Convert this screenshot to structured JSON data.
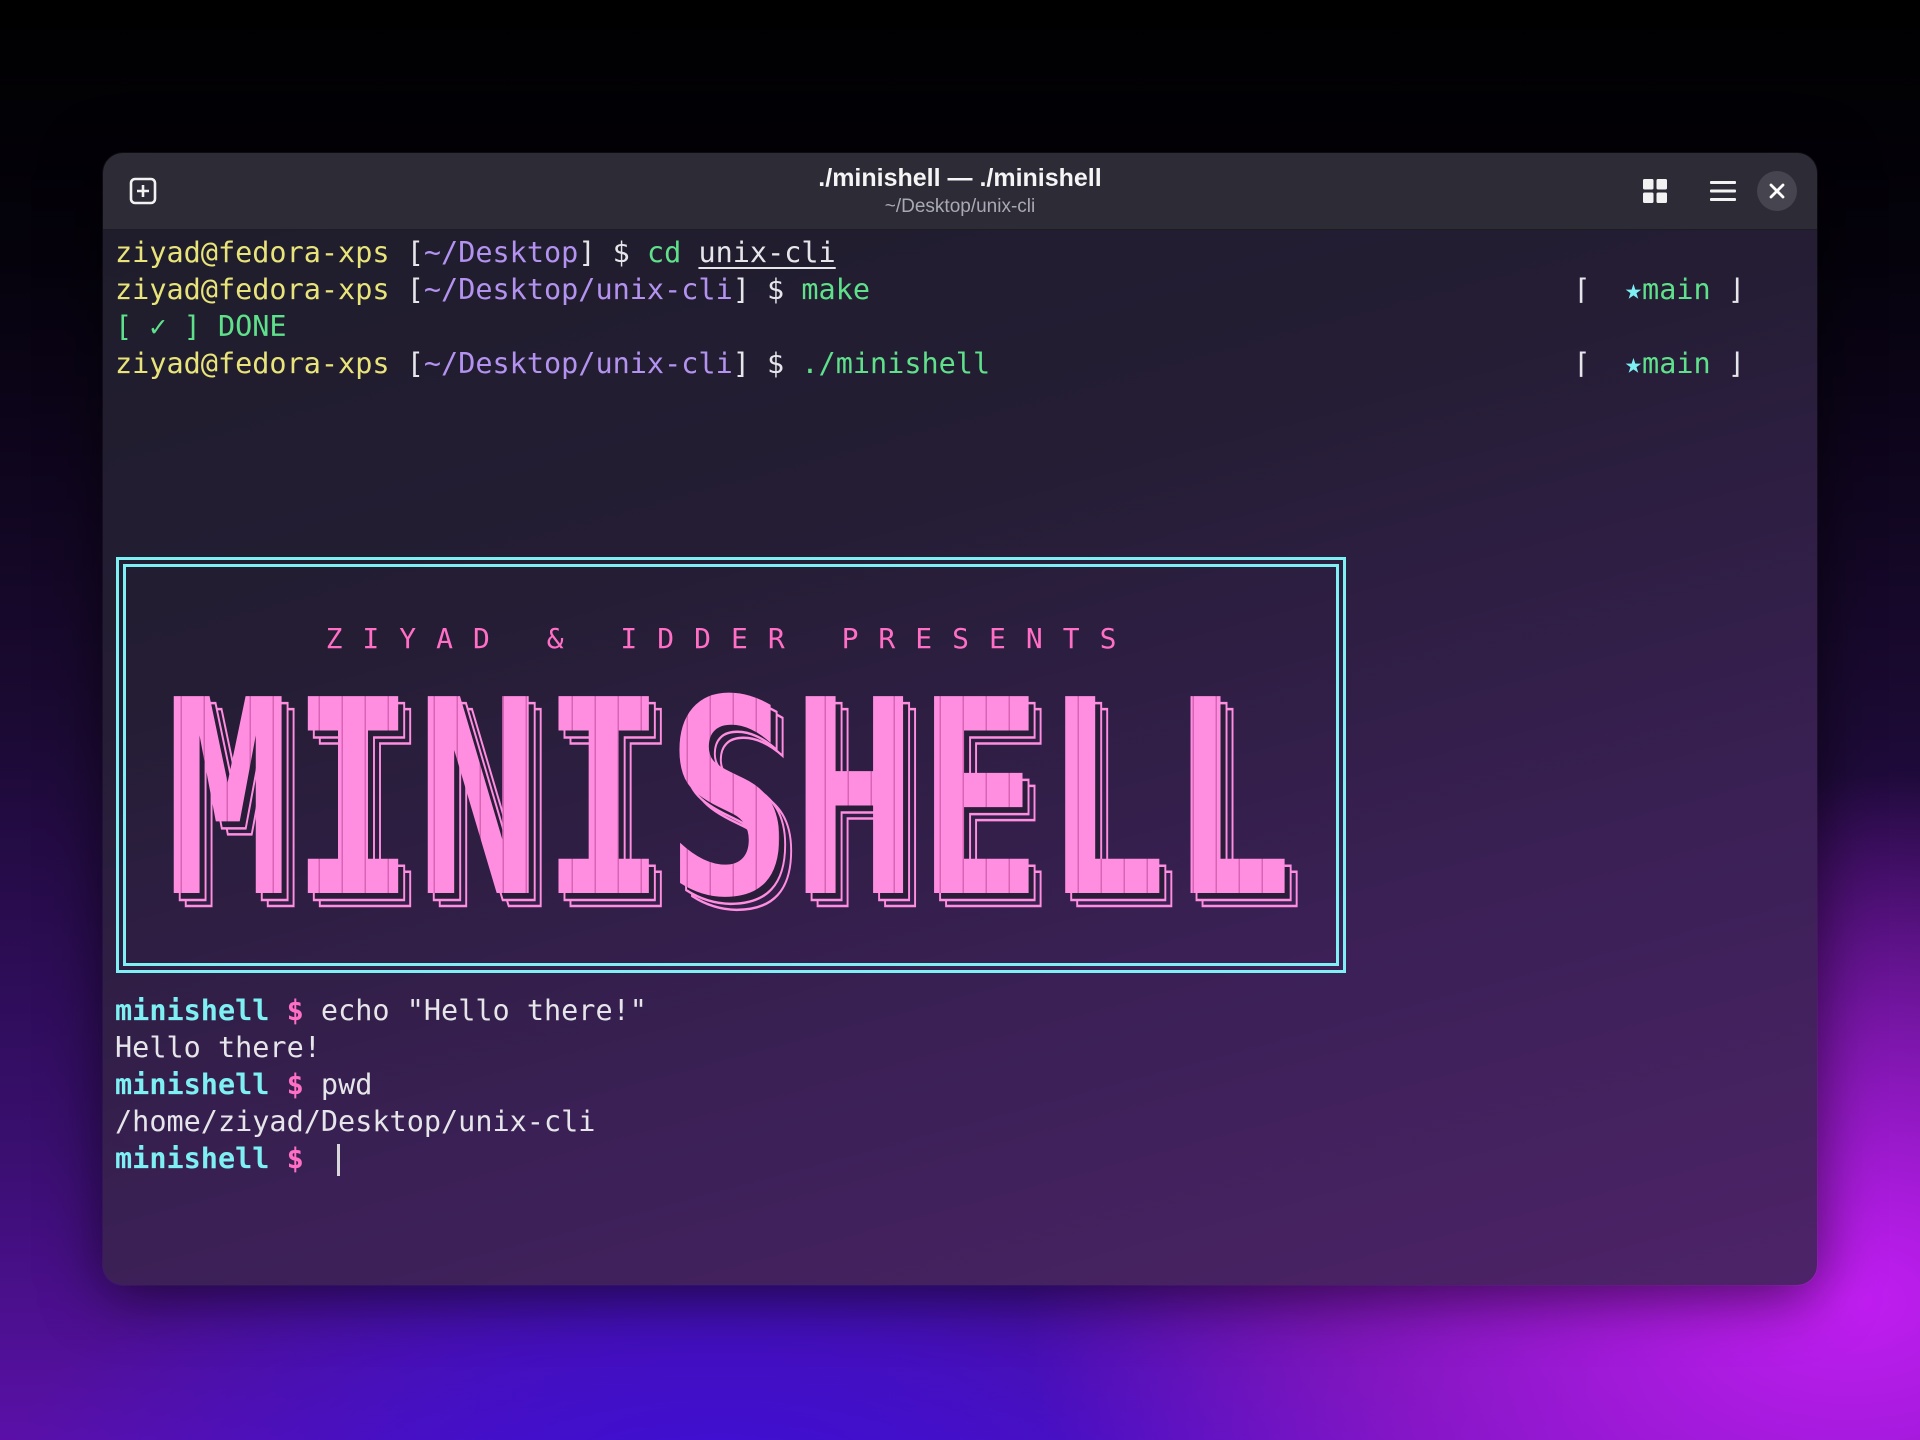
{
  "window": {
    "title": "./minishell — ./minishell",
    "subtitle": "~/Desktop/unix-cli"
  },
  "icons": {
    "new_tab": "new-tab-plus-icon",
    "grid": "grid-view-icon",
    "menu": "hamburger-menu-icon",
    "close": "close-icon"
  },
  "colors": {
    "user": "#e8e47a",
    "path": "#b392f0",
    "command": "#5fe08a",
    "prompt_name": "#7ef0f4",
    "prompt_dollar": "#ff6fc6",
    "banner_border": "#7ef0f4",
    "banner_text": "#ff6fc6"
  },
  "terminal": {
    "line1": {
      "user": "ziyad@fedora-xps",
      "open": " [",
      "path": "~/Desktop",
      "close": "] $ ",
      "cmd": "cd ",
      "arg": "unix-cli"
    },
    "line2": {
      "user": "ziyad@fedora-xps",
      "open": " [",
      "path": "~/Desktop/unix-cli",
      "close": "] $ ",
      "cmd": "make"
    },
    "line3": {
      "text": "[ ✓ ] DONE"
    },
    "line4": {
      "user": "ziyad@fedora-xps",
      "open": " [",
      "path": "~/Desktop/unix-cli",
      "close": "] $ ",
      "cmd": "./minishell"
    },
    "branch": {
      "open": "⌈ ",
      "star": " ★",
      "name": "main",
      "close": " ⌋"
    }
  },
  "banner": {
    "presents": "ZIYAD & IDDER PRESENTS",
    "logo": "MINISHELL"
  },
  "shell": {
    "prompt_name": "minishell",
    "prompt_dollar": " $ ",
    "cmd1": "echo \"Hello there!\"",
    "out1": "Hello there!",
    "cmd2": "pwd",
    "out2": "/home/ziyad/Desktop/unix-cli"
  }
}
